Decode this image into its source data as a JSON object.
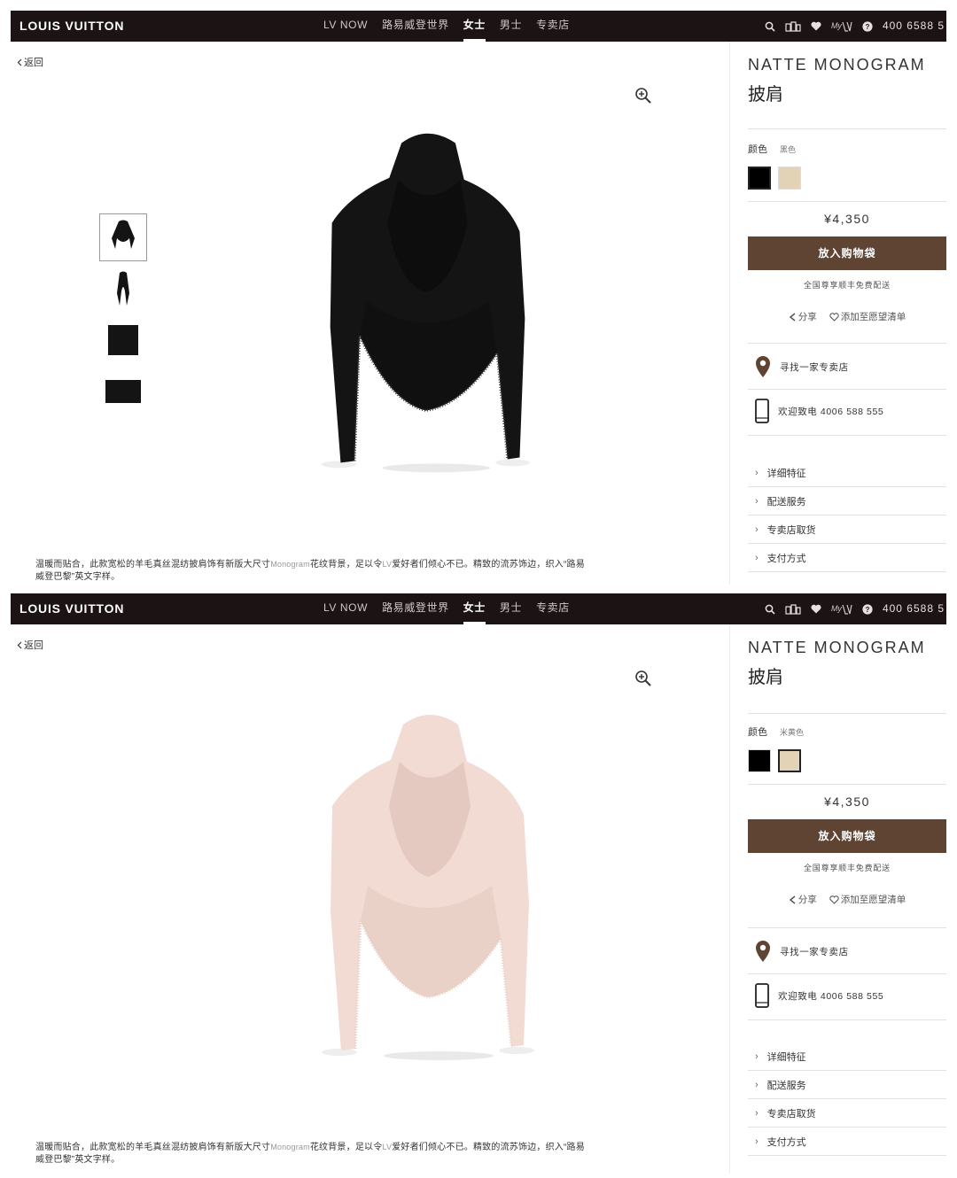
{
  "nav": {
    "logo": "LOUIS VUITTON",
    "items": [
      "LV NOW",
      "路易威登世界",
      "女士",
      "男士",
      "专卖店"
    ],
    "active_index": 2,
    "mylv": "My",
    "phone": "400 6588 5"
  },
  "back_label": "返回",
  "product": {
    "name": "NATTE MONOGRAM",
    "type": "披肩",
    "color_label": "颜色",
    "price": "¥4,350",
    "add_to_bag": "放入购物袋",
    "shipping": "全国尊享顺丰免费配送",
    "share": "分享",
    "wishlist": "添加至愿望清单",
    "find_store": "寻找一家专卖店",
    "call": "欢迎致电 4006 588 555",
    "accordion": [
      "详细特征",
      "配送服务",
      "专卖店取货",
      "支付方式"
    ]
  },
  "description": {
    "part1": "温暖而贴合，此款宽松的羊毛真丝混纺披肩饰有新版大尺寸",
    "mono": "Monogram",
    "part2": "花纹背景，足以令",
    "lv": "LV",
    "part3": "爱好者们倾心不已。精致的流苏饰边，织入“路易",
    "line2": "威登巴黎”英文字样。"
  },
  "screens": [
    {
      "selected_color": "黑色",
      "selected_swatch": 0,
      "scarf_color": "#141414",
      "fringe_color": "#3a3a3a"
    },
    {
      "selected_color": "米黄色",
      "selected_swatch": 1,
      "scarf_color": "#f2dbd3",
      "fringe_color": "#e8d0c6"
    }
  ],
  "swatches": [
    "#000000",
    "#e3d3b6"
  ]
}
